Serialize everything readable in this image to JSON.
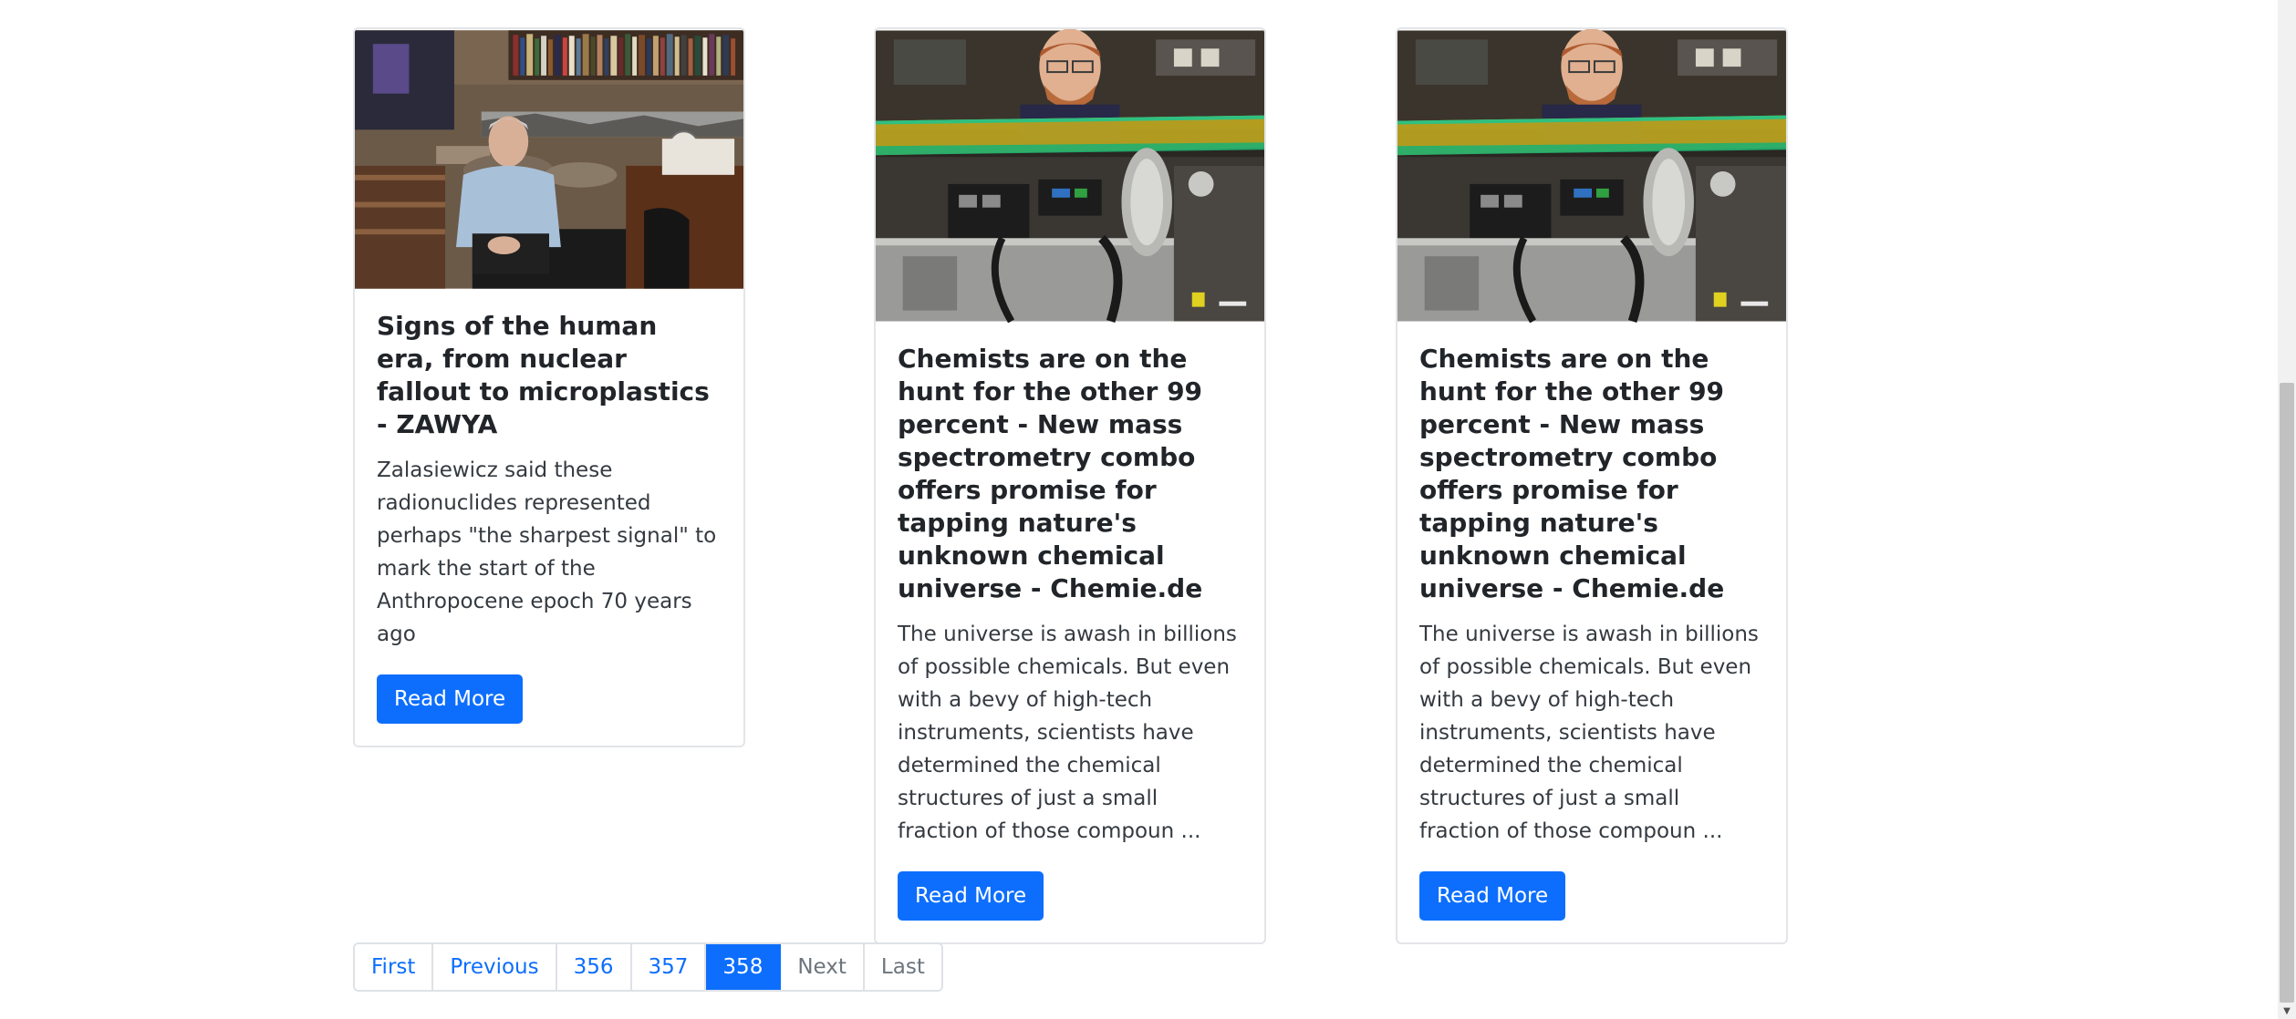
{
  "cards": [
    {
      "title": "Signs of the human era, from nuclear fallout to microplastics - ZAWYA",
      "text": "Zalasiewicz said these radionuclides represented perhaps \"the sharpest signal\" to mark the start of the Anthropocene epoch 70 years ago",
      "button": "Read More"
    },
    {
      "title": "Chemists are on the hunt for the other 99 percent - New mass spectrometry combo offers promise for tapping nature's unknown chemical universe - Chemie.de",
      "text": "The universe is awash in billions of possible chemicals. But even with a bevy of high-tech instruments, scientists have determined the chemical structures of just a small fraction of those compoun ...",
      "button": "Read More"
    },
    {
      "title": "Chemists are on the hunt for the other 99 percent - New mass spectrometry combo offers promise for tapping nature's unknown chemical universe - Chemie.de",
      "text": "The universe is awash in billions of possible chemicals. But even with a bevy of high-tech instruments, scientists have determined the chemical structures of just a small fraction of those compoun ...",
      "button": "Read More"
    }
  ],
  "pagination": {
    "first": "First",
    "previous": "Previous",
    "pages": [
      "356",
      "357",
      "358"
    ],
    "active_page": "358",
    "next": "Next",
    "last": "Last"
  },
  "colors": {
    "primary": "#0d6efd",
    "disabled": "#6c757d"
  }
}
